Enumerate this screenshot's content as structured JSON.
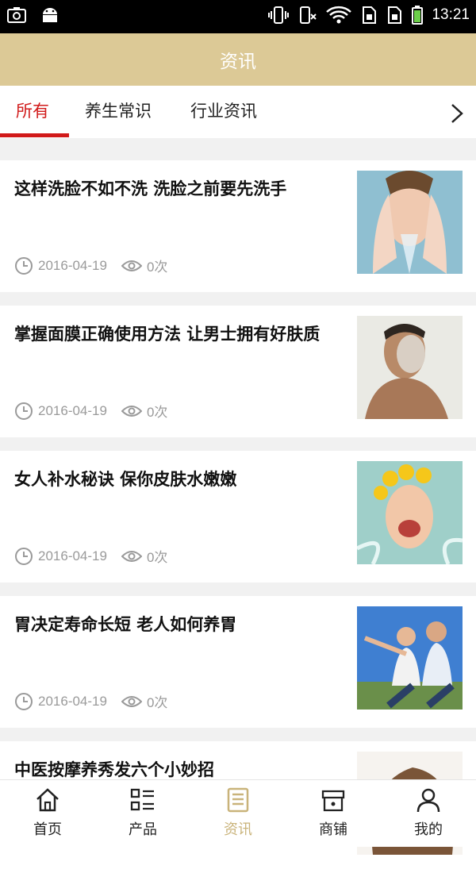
{
  "status": {
    "time": "13:21"
  },
  "header": {
    "title": "资讯"
  },
  "tabs": [
    {
      "label": "所有",
      "active": true
    },
    {
      "label": "养生常识",
      "active": false
    },
    {
      "label": "行业资讯",
      "active": false
    }
  ],
  "articles": [
    {
      "title": "这样洗脸不如不洗 洗脸之前要先洗手",
      "date": "2016-04-19",
      "views": "0次"
    },
    {
      "title": "掌握面膜正确使用方法 让男士拥有好肤质",
      "date": "2016-04-19",
      "views": "0次"
    },
    {
      "title": "女人补水秘诀 保你皮肤水嫩嫩",
      "date": "2016-04-19",
      "views": "0次"
    },
    {
      "title": "胃决定寿命长短 老人如何养胃",
      "date": "2016-04-19",
      "views": "0次"
    },
    {
      "title": "中医按摩养秀发六个小妙招",
      "date": "",
      "views": ""
    }
  ],
  "nav": [
    {
      "label": "首页",
      "icon": "home-icon"
    },
    {
      "label": "产品",
      "icon": "list-icon"
    },
    {
      "label": "资讯",
      "icon": "news-icon",
      "active": true
    },
    {
      "label": "商铺",
      "icon": "shop-icon"
    },
    {
      "label": "我的",
      "icon": "user-icon"
    }
  ],
  "colors": {
    "accent": "#dcc996",
    "active_tab": "#d11a1a",
    "nav_active": "#c9b37a"
  }
}
